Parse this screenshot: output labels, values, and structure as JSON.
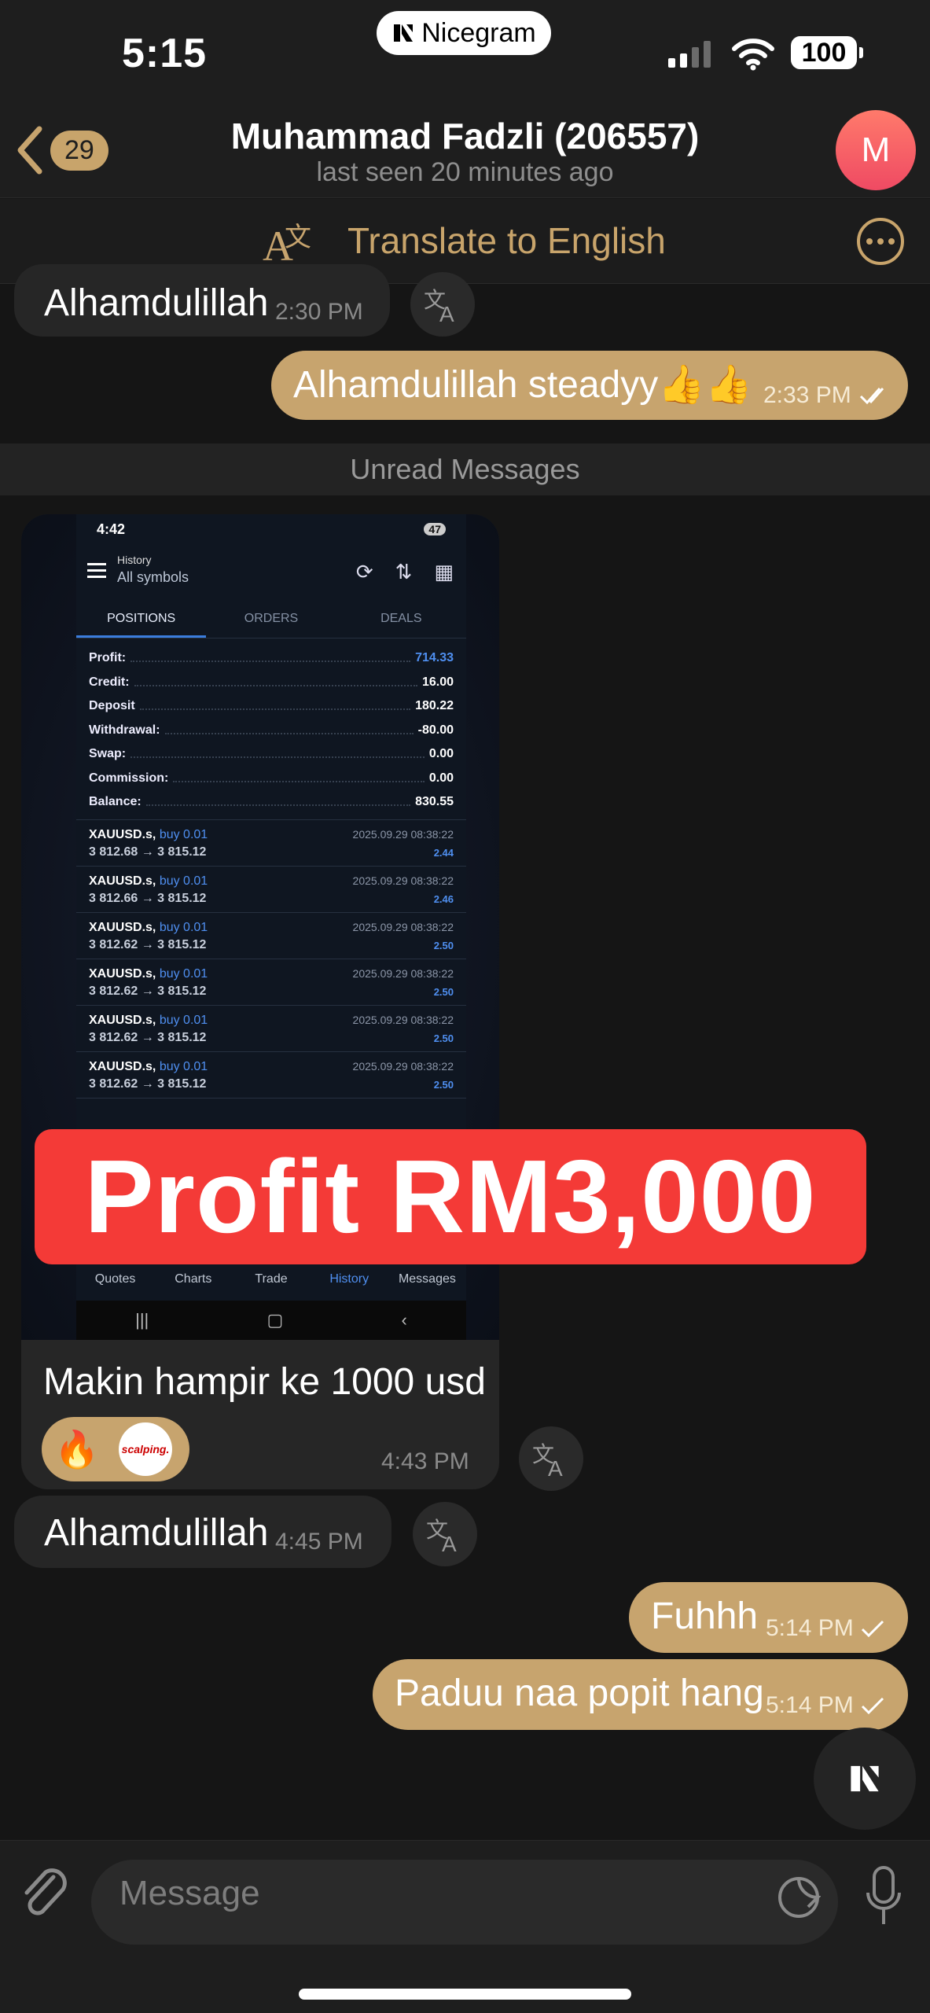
{
  "status_bar": {
    "time": "5:15",
    "app_name": "Nicegram",
    "battery": "100"
  },
  "header": {
    "back_count": "29",
    "title": "Muhammad Fadzli (206557)",
    "subtitle": "last seen 20 minutes ago",
    "avatar_letter": "M"
  },
  "translate_bar": {
    "label": "Translate to English"
  },
  "messages": [
    {
      "dir": "in",
      "text": "Alhamdulillah",
      "time": "2:30 PM"
    },
    {
      "dir": "out",
      "text": "Alhamdulillah steadyy👍👍",
      "time": "2:33 PM",
      "status": "read"
    },
    {
      "dir": "in",
      "text": "Makin hampir ke 1000 usd",
      "time": "4:43 PM",
      "has_photo": true,
      "reaction": "🔥"
    },
    {
      "dir": "in",
      "text": "Alhamdulillah",
      "time": "4:45 PM"
    },
    {
      "dir": "out",
      "text": "Fuhhh",
      "time": "5:14 PM",
      "status": "sent"
    },
    {
      "dir": "out",
      "text": "Paduu naa popit hang",
      "time": "5:14 PM",
      "status": "sent"
    }
  ],
  "unread_label": "Unread Messages",
  "screenshot": {
    "status_time": "4:42",
    "status_right": "47",
    "header_small": "History",
    "header_filter": "All symbols",
    "tabs": [
      "POSITIONS",
      "ORDERS",
      "DEALS"
    ],
    "summary": [
      {
        "label": "Profit:",
        "value": "714.33"
      },
      {
        "label": "Credit:",
        "value": "16.00"
      },
      {
        "label": "Deposit",
        "value": "180.22"
      },
      {
        "label": "Withdrawal:",
        "value": "-80.00"
      },
      {
        "label": "Swap:",
        "value": "0.00"
      },
      {
        "label": "Commission:",
        "value": "0.00"
      },
      {
        "label": "Balance:",
        "value": "830.55"
      }
    ],
    "deals": [
      {
        "symbol": "XAUUSD.s,",
        "side": "buy 0.01",
        "prices": "3 812.68 → 3 815.12",
        "date": "2025.09.29 08:38:22",
        "pnl": "2.44"
      },
      {
        "symbol": "XAUUSD.s,",
        "side": "buy 0.01",
        "prices": "3 812.66 → 3 815.12",
        "date": "2025.09.29 08:38:22",
        "pnl": "2.46"
      },
      {
        "symbol": "XAUUSD.s,",
        "side": "buy 0.01",
        "prices": "3 812.62 → 3 815.12",
        "date": "2025.09.29 08:38:22",
        "pnl": "2.50"
      },
      {
        "symbol": "XAUUSD.s,",
        "side": "buy 0.01",
        "prices": "3 812.62 → 3 815.12",
        "date": "2025.09.29 08:38:22",
        "pnl": "2.50"
      },
      {
        "symbol": "XAUUSD.s,",
        "side": "buy 0.01",
        "prices": "3 812.62 → 3 815.12",
        "date": "2025.09.29 08:38:22",
        "pnl": "2.50"
      },
      {
        "symbol": "XAUUSD.s,",
        "side": "buy 0.01",
        "prices": "3 812.62 → 3 815.12",
        "date": "2025.09.29 08:38:22",
        "pnl": "2.50"
      }
    ],
    "nav": [
      "Quotes",
      "Charts",
      "Trade",
      "History",
      "Messages"
    ],
    "overlay_text": "Profit RM3,000"
  },
  "reaction_avatar_text": "scalping.",
  "input": {
    "placeholder": "Message"
  },
  "colors": {
    "accent": "#c7a46e",
    "background": "#151515",
    "overlay_red": "#f43a37",
    "link_blue": "#4f8ff0"
  }
}
